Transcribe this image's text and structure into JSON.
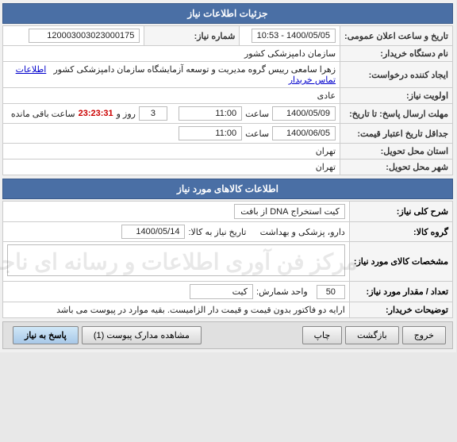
{
  "page": {
    "section1_title": "جزئیات اطلاعات نیاز",
    "section2_title": "اطلاعات کالاهای مورد نیاز",
    "fields": {
      "order_number_label": "شماره نیاز:",
      "order_number_value": "120003003023000175",
      "date_time_label": "تاریخ و ساعت اعلان عمومی:",
      "date_time_value": "1400/05/05 - 10:53",
      "buyer_label": "نام دستگاه خریدار:",
      "buyer_value": "سازمان دامپزشکی کشور",
      "origin_label": "ایجاد کننده درخواست:",
      "origin_value": "زهرا سامعی رییس گروه مدیریت و توسعه آزمایشگاه سازمان دامپزشکی کشور",
      "origin_link": "اطلاعات تماس خریدار",
      "priority_label": "اولویت نیاز:",
      "priority_value": "عادی",
      "send_date_label": "مهلت ارسال پاسخ: تا تاریخ:",
      "send_date_value": "1400/05/09",
      "send_time_label": "ساعت",
      "send_time_value": "11:00",
      "days_label": "روز و",
      "days_value": "3",
      "remaining_label": "ساعت باقی مانده",
      "remaining_value": "23:23:31",
      "deal_date_label": "جداقل تاریخ اعتبار قیمت:",
      "deal_date_value": "1400/06/05",
      "deal_time_label": "ساعت",
      "deal_time_value": "11:00",
      "province_label": "استان محل تحویل:",
      "province_value": "تهران",
      "city_label": "شهر محل تحویل:",
      "city_value": "تهران"
    },
    "goods": {
      "type_label": "شرح کلی نیاز:",
      "type_value": "کیت استخراج   DNA  از بافت",
      "group_label": "گروه کالا:",
      "group_value": "دارو، پزشکی و بهداشت",
      "date_label": "تاریخ نیاز به کالا:",
      "date_value": "1400/05/14",
      "detail_label": "مشخصات کالای مورد نیاز:",
      "detail_value": "",
      "watermark": "مرکز فن آوری اطلاعات و رسانه ای ناجا",
      "count_label": "تعداد / مقدار مورد نیاز:",
      "count_value": "50",
      "unit_label": "واحد شمارش:",
      "unit_value": "کیت",
      "notes_label": "توضیحات خریدار:",
      "notes_value": "ارایه دو فاکتور بدون قیمت و قیمت دار الزامیست. بقیه موارد در پیوست می باشد"
    },
    "buttons": {
      "reply_label": "پاسخ به نیاز",
      "view_label": "مشاهده مدارک پیوست (1)",
      "print_label": "چاپ",
      "back_label": "بازگشت",
      "exit_label": "خروج"
    }
  }
}
